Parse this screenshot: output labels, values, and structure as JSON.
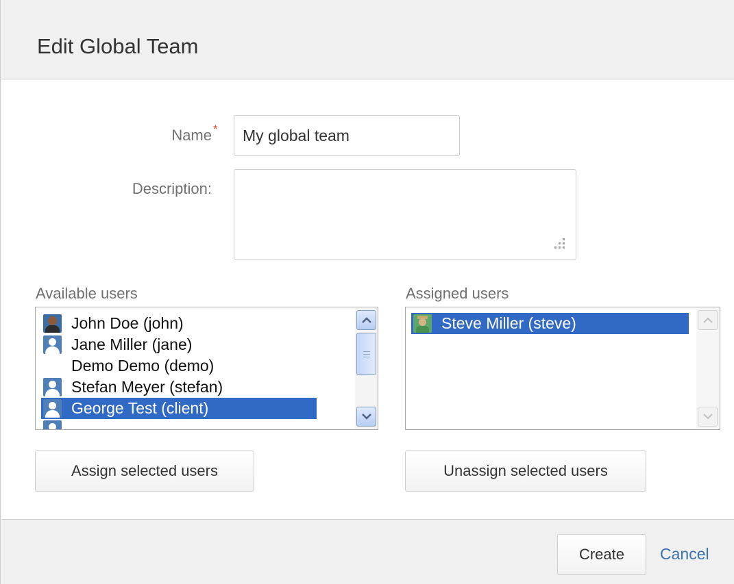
{
  "dialog": {
    "title": "Edit Global Team"
  },
  "form": {
    "name_label": "Name",
    "name_required_marker": "*",
    "name_value": "My global team",
    "description_label": "Description:",
    "description_value": ""
  },
  "available": {
    "label": "Available users",
    "items": [
      {
        "label": "John Doe (john)",
        "avatar": "photo-avatar-icon",
        "selected": false
      },
      {
        "label": "Jane Miller (jane)",
        "avatar": "default-avatar-icon",
        "selected": false
      },
      {
        "label": "Demo Demo (demo)",
        "avatar": "none",
        "selected": false
      },
      {
        "label": "Stefan Meyer (stefan)",
        "avatar": "default-avatar-icon",
        "selected": false
      },
      {
        "label": "George Test (client)",
        "avatar": "default-avatar-icon",
        "selected": true
      }
    ],
    "assign_button": "Assign selected users"
  },
  "assigned": {
    "label": "Assigned users",
    "items": [
      {
        "label": "Steve Miller (steve)",
        "avatar": "green-avatar-icon",
        "selected": true
      }
    ],
    "unassign_button": "Unassign selected users"
  },
  "footer": {
    "create_button": "Create",
    "cancel_link": "Cancel"
  },
  "colors": {
    "selection": "#316ac5",
    "link": "#3b73af",
    "required": "#d04437"
  }
}
